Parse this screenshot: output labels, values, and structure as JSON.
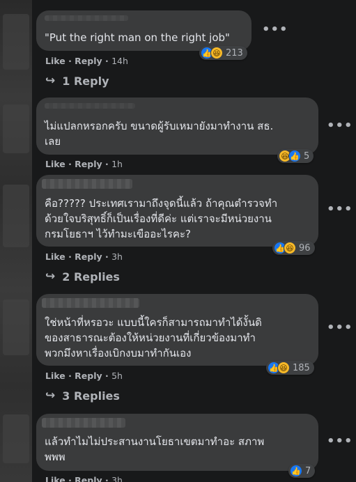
{
  "comments": [
    {
      "text_lines": [
        "\"Put the right man on the right job\""
      ],
      "like_label": "Like",
      "reply_label": "Reply",
      "time": "14h",
      "reaction_count": "213",
      "replies_label": "1 Reply"
    },
    {
      "text_lines": [
        "ไม่แปลกหรอกครับ ขนาดผู้รับเหมายังมาทำงาน สธ.",
        "เลย"
      ],
      "like_label": "Like",
      "reply_label": "Reply",
      "time": "1h",
      "reaction_count": "5"
    },
    {
      "text_lines": [
        "คือ????? ประเทศเรามาถึงจุดนี้แล้ว ถ้าคุณตำรวจทำ",
        "ด้วยใจบริสุทธิ์ก็เป็นเรื่องที่ดีค่ะ แต่เราจะมีหน่วยงาน",
        "กรมโยธาฯ ไว้ทำมะเขืออะไรคะ?"
      ],
      "like_label": "Like",
      "reply_label": "Reply",
      "time": "3h",
      "reaction_count": "96",
      "replies_label": "2 Replies"
    },
    {
      "text_lines": [
        "ใช่หน้าที่หรอวะ แบบนี้ใครก็สามารถมาทำได้งั้นดิ",
        "ของสาธารณะต้องให้หน่วยงานที่เกี่ยวข้องมาทำ",
        "พวกมึงหาเรื่องเบิกงบมาทำกันเอง"
      ],
      "like_label": "Like",
      "reply_label": "Reply",
      "time": "5h",
      "reaction_count": "185",
      "replies_label": "3 Replies"
    },
    {
      "text_lines": [
        "แล้วทำไมไม่ประสานงานโยธาเขตมาทำอะ สภาพ",
        "พพพ"
      ],
      "like_label": "Like",
      "reply_label": "Reply",
      "time": "3h",
      "reaction_count": "7"
    }
  ],
  "icons": {
    "more": "more-dots-icon",
    "like": "like-reaction-icon",
    "haha": "haha-reaction-icon",
    "reply_arrow": "reply-arrow-icon"
  },
  "colors": {
    "background": "#18191a",
    "bubble": "#3a3b3c",
    "like_blue": "#1877f2",
    "haha_yellow": "#f7b928",
    "muted_text": "#b0b3b8"
  }
}
